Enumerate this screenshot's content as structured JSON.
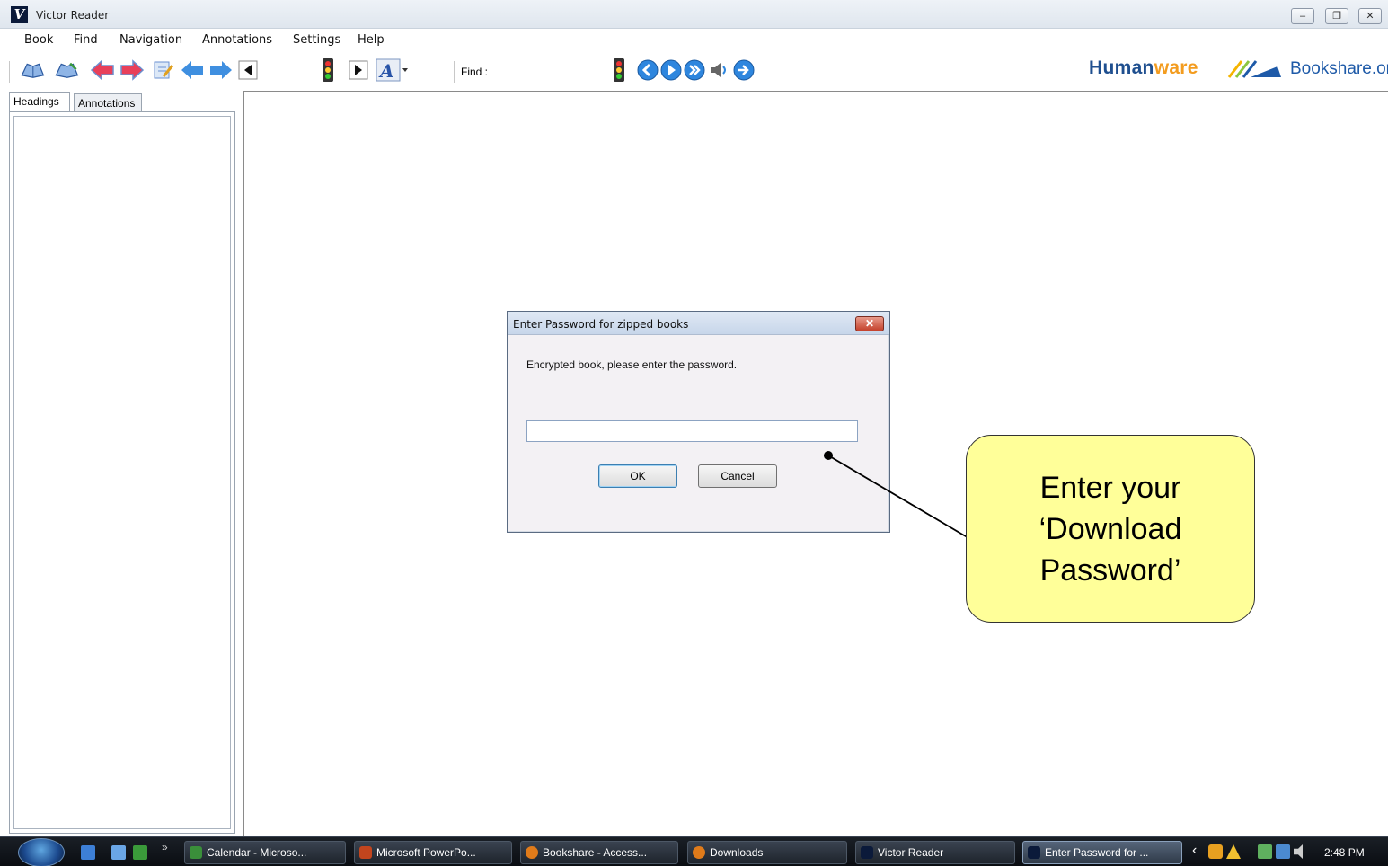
{
  "window": {
    "title": "Victor Reader",
    "logo_letter": "V",
    "controls": {
      "minimize": "–",
      "restore": "❐",
      "close": "✕"
    }
  },
  "menu": [
    "Book",
    "Find",
    "Navigation",
    "Annotations",
    "Settings",
    "Help"
  ],
  "toolbar": {
    "find_label": "Find :",
    "find_value": "",
    "font_button_label": "A",
    "icons": [
      "open-book-icon",
      "edit-book-icon",
      "back-arrow-icon",
      "forward-arrow-icon",
      "bookmark-icon",
      "prev-icon",
      "next-icon",
      "rewind-icon",
      "traffic-light-icon",
      "play-icon",
      "font-icon",
      "traffic-light-icon",
      "prev-circle-icon",
      "play-circle-icon",
      "next-circle-icon",
      "volume-icon",
      "skip-circle-icon"
    ]
  },
  "branding": {
    "humanware_part1": "Human",
    "humanware_part2": "ware",
    "bookshare": "Bookshare.org"
  },
  "sidebar": {
    "tabs": [
      "Headings",
      "Annotations"
    ],
    "active_tab": "Headings"
  },
  "dialog": {
    "title": "Enter Password for zipped books",
    "close_label": "✕",
    "message": "Encrypted book, please enter the password.",
    "password_value": "",
    "ok_label": "OK",
    "cancel_label": "Cancel"
  },
  "callout": {
    "text": "Enter your\n‘Download\nPassword’"
  },
  "taskbar": {
    "chevron": "»",
    "tasks": [
      {
        "label": "Calendar - Microso...",
        "icon": "calendar-icon",
        "color": "#3a8f3a"
      },
      {
        "label": "Microsoft PowerPo...",
        "icon": "powerpoint-icon",
        "color": "#c2451e"
      },
      {
        "label": "Bookshare - Access...",
        "icon": "firefox-icon",
        "color": "#e07b1a"
      },
      {
        "label": "Downloads",
        "icon": "firefox-icon",
        "color": "#e07b1a"
      },
      {
        "label": "Victor Reader",
        "icon": "victor-reader-icon",
        "color": "#0b1a3a"
      },
      {
        "label": "Enter Password for ...",
        "icon": "victor-reader-icon",
        "color": "#0b1a3a",
        "active": true
      }
    ],
    "tray_arrow": "‹",
    "time": "2:48 PM"
  }
}
